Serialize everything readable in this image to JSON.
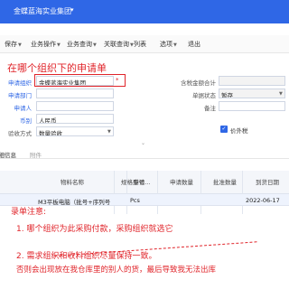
{
  "topbar": {
    "org_name": "金蝶蓝海实业集团"
  },
  "toolbar": {
    "items": [
      {
        "label": "保存",
        "dropdown": true
      },
      {
        "label": "业务操作",
        "dropdown": true
      },
      {
        "label": "业务查询",
        "dropdown": true
      },
      {
        "label": "关联查询",
        "dropdown": true
      },
      {
        "label": "列表",
        "dropdown": false
      },
      {
        "label": "选项",
        "dropdown": true
      },
      {
        "label": "退出",
        "dropdown": false
      }
    ]
  },
  "annotation_title": "在哪个组织下的申请单",
  "form": {
    "apply_org_label": "申请组织",
    "apply_org_value": "金蝶蓝海实业集团",
    "apply_dept_label": "申请部门",
    "applicant_label": "申请人",
    "currency_label": "币别",
    "currency_value": "人民币",
    "acceptance_label": "验收方式",
    "acceptance_value": "数量验收",
    "total_label": "含税金额合计",
    "status_label": "单据状态",
    "status_value": "暂存",
    "remark_label": "备注",
    "tax_included_label": "价外税"
  },
  "subtabs": {
    "detail": "明细信息",
    "attachment": "附件"
  },
  "grid": {
    "columns": [
      "物料名称",
      "规格型号",
      "申请...",
      "申请数量",
      "批准数量",
      "到货日期"
    ],
    "rows": [
      {
        "material": "M3平板电脑（批号+序列号",
        "spec": "",
        "unit": "Pcs",
        "apply_qty": "",
        "approved_qty": "",
        "arrival_date": "2022-06-17"
      }
    ]
  },
  "notes": {
    "heading": "录单注意:",
    "line1": "1. 哪个组织为此采购付款，采购组织就选它",
    "line2": "2. 需求组织和收料组织尽量保持一致。",
    "line3": "否则会出现放在我仓库里的别人的货，最后导致我无法出库"
  },
  "colors": {
    "brand": "#2f67e6",
    "annotation": "#e0242a"
  }
}
